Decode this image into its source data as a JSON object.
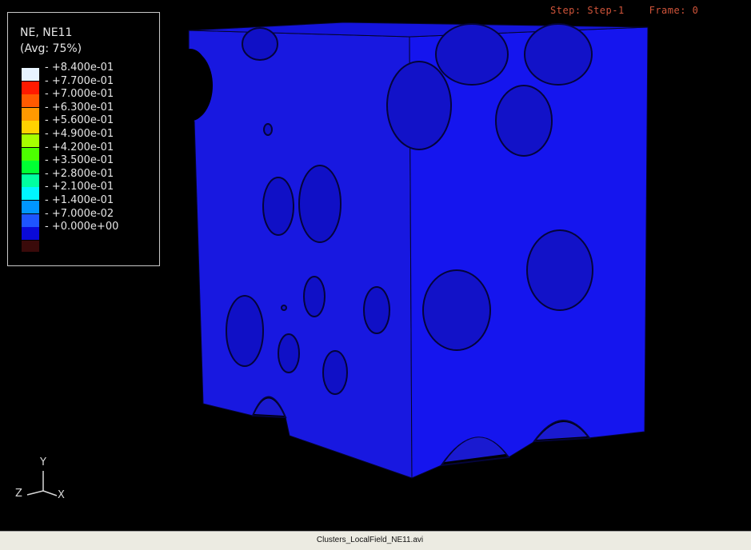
{
  "viewport": {
    "step_frame_text": "Step: Step-1    Frame: 0",
    "background": "#000000",
    "model_color": "#1414e6"
  },
  "legend": {
    "title": "NE, NE11",
    "subtitle": "(Avg: 75%)",
    "entries": [
      {
        "label": "+8.400e-01",
        "color": "#e8f4ff"
      },
      {
        "label": "+7.700e-01",
        "color": "#ff1a00"
      },
      {
        "label": "+7.000e-01",
        "color": "#ff5a00"
      },
      {
        "label": "+6.300e-01",
        "color": "#ff9900"
      },
      {
        "label": "+5.600e-01",
        "color": "#ffd200"
      },
      {
        "label": "+4.900e-01",
        "color": "#a6ff00"
      },
      {
        "label": "+4.200e-01",
        "color": "#4cff00"
      },
      {
        "label": "+3.500e-01",
        "color": "#00ff33"
      },
      {
        "label": "+2.800e-01",
        "color": "#00ffa0"
      },
      {
        "label": "+2.100e-01",
        "color": "#00f5ff"
      },
      {
        "label": "+1.400e-01",
        "color": "#0096ff"
      },
      {
        "label": "+7.000e-02",
        "color": "#1e55ff"
      },
      {
        "label": "+0.000e+00",
        "color": "#0a0ad8"
      }
    ],
    "bottom_swatch_color": "#3a0a0a"
  },
  "triad": {
    "x": "X",
    "y": "Y",
    "z": "Z"
  },
  "status_bar": {
    "file_name": "Clusters_LocalField_NE11.avi"
  }
}
